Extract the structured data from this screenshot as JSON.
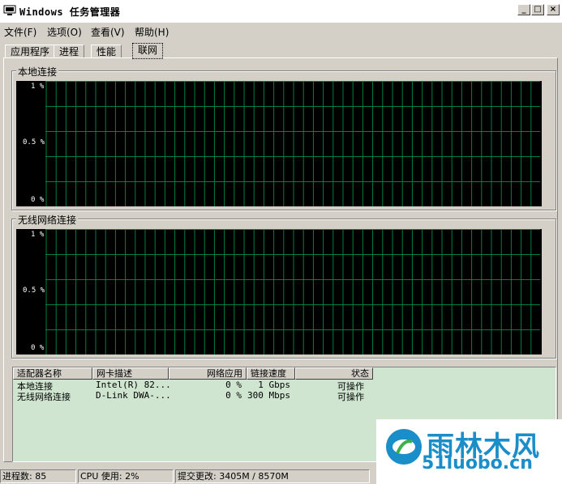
{
  "window": {
    "title": "Windows 任务管理器",
    "controls": {
      "minimize": "_",
      "maximize": "□",
      "close": "×"
    }
  },
  "menu": [
    "文件(F)",
    "选项(O)",
    "查看(V)",
    "帮助(H)"
  ],
  "tabs": [
    "应用程序",
    "进程",
    "性能",
    "联网"
  ],
  "active_tab": "联网",
  "graphs": [
    {
      "label": "本地连接",
      "y_top": "1 %",
      "y_mid": "0.5 %",
      "y_bottom": "0 %"
    },
    {
      "label": "无线网络连接",
      "y_top": "1 %",
      "y_mid": "0.5 %",
      "y_bottom": "0 %"
    }
  ],
  "table": {
    "headers": [
      "适配器名称",
      "网卡描述",
      "网络应用",
      "链接速度",
      "状态"
    ],
    "rows": [
      [
        "本地连接",
        "Intel(R) 82...",
        "0 %",
        "1 Gbps",
        "可操作"
      ],
      [
        "无线网络连接",
        "D-Link DWA-...",
        "0 %",
        "300 Mbps",
        "可操作"
      ]
    ]
  },
  "status": {
    "processes": "进程数: 85",
    "cpu": "CPU 使用: 2%",
    "commit": "提交更改: 3405M / 8570M"
  },
  "watermark": {
    "title": "雨林木风",
    "url": "51luobo.cn"
  },
  "colors": {
    "graph_bg": "#000000",
    "grid": "#008040",
    "list_bg": "#cfe5d0"
  }
}
